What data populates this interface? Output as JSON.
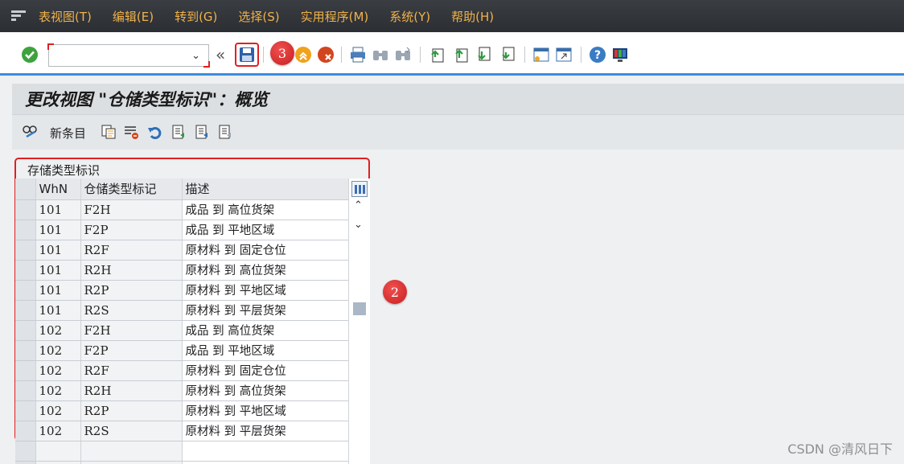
{
  "menu": {
    "items": [
      "表视图(T)",
      "编辑(E)",
      "转到(G)",
      "选择(S)",
      "实用程序(M)",
      "系统(Y)",
      "帮助(H)"
    ]
  },
  "toolbar": {
    "command_value": "",
    "icons": [
      "enter-check-icon",
      "save-icon",
      "back-icon",
      "exit-icon",
      "cancel-icon",
      "print-icon",
      "find-icon",
      "find-next-icon",
      "first-page-icon",
      "previous-page-icon",
      "next-page-icon",
      "last-page-icon",
      "create-session-icon",
      "shortcut-icon",
      "help-icon",
      "customize-layout-icon"
    ],
    "history_glyph": "«"
  },
  "callouts": {
    "save": "3",
    "table": "2"
  },
  "title": "更改视图 \"仓储类型标识\"：概览",
  "app_toolbar": {
    "new_entries_label": "新条目"
  },
  "table": {
    "title": "存储类型标识",
    "columns": [
      "WhN",
      "仓储类型标记",
      "描述"
    ],
    "rows": [
      [
        "101",
        "F2H",
        "成品 到 高位货架"
      ],
      [
        "101",
        "F2P",
        "成品 到 平地区域"
      ],
      [
        "101",
        "R2F",
        "原材料 到 固定仓位"
      ],
      [
        "101",
        "R2H",
        "原材料 到 高位货架"
      ],
      [
        "101",
        "R2P",
        "原材料 到 平地区域"
      ],
      [
        "101",
        "R2S",
        "原材料 到 平层货架"
      ],
      [
        "102",
        "F2H",
        "成品 到 高位货架"
      ],
      [
        "102",
        "F2P",
        "成品 到 平地区域"
      ],
      [
        "102",
        "R2F",
        "原材料 到 固定仓位"
      ],
      [
        "102",
        "R2H",
        "原材料 到 高位货架"
      ],
      [
        "102",
        "R2P",
        "原材料 到 平地区域"
      ],
      [
        "102",
        "R2S",
        "原材料 到 平层货架"
      ]
    ]
  },
  "watermark": "CSDN @清风日下",
  "colors": {
    "menubar": "#2b2e33",
    "menu_text": "#f0b24a",
    "accent": "#3b8de0",
    "callout": "#e02020"
  }
}
